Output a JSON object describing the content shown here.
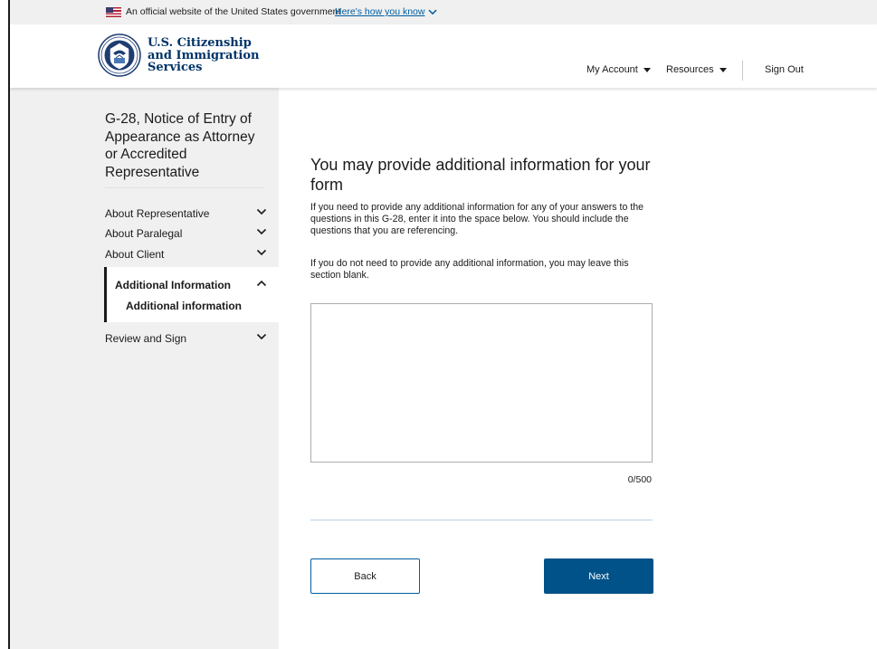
{
  "banner": {
    "text": "An official website of the United States government",
    "link": "Here's how you know",
    "flag_icon": "us-flag-icon",
    "chevron_icon": "chevron-down-icon"
  },
  "header": {
    "agency_line1": "U.S. Citizenship",
    "agency_line2": "and Immigration",
    "agency_line3": "Services",
    "seal_icon": "dhs-seal-icon",
    "nav": {
      "my_account": "My Account",
      "resources": "Resources",
      "sign_out": "Sign Out"
    }
  },
  "sidebar": {
    "title": "G-28, Notice of Entry of Appearance as Attorney or Accredited Representative",
    "items": [
      {
        "label": "About Representative",
        "state": "collapsed"
      },
      {
        "label": "About Paralegal",
        "state": "collapsed"
      },
      {
        "label": "About Client",
        "state": "collapsed"
      },
      {
        "label": "Additional Information",
        "state": "expanded",
        "sub": "Additional information"
      },
      {
        "label": "Review and Sign",
        "state": "collapsed"
      }
    ]
  },
  "main": {
    "title": "You may provide additional information for your form",
    "para1": "If you need to provide any additional information for any of your answers to the questions in this G-28, enter it into the space below. You should include the questions that you are referencing.",
    "para2": "If you do not need to provide any additional information, you may leave this section blank.",
    "textarea_value": "",
    "counter": "0/500",
    "back_label": "Back",
    "next_label": "Next"
  },
  "colors": {
    "primary": "#005288",
    "link": "#005ea2",
    "sidebar_bg": "#f0f0f0",
    "agency_text": "#003366"
  }
}
